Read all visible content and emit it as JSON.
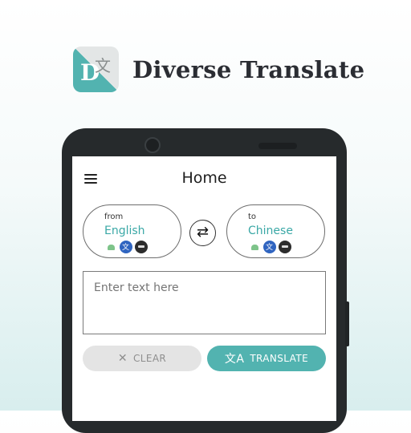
{
  "brand": {
    "logo_letter": "D",
    "logo_glyph": "文",
    "name": "Diverse Translate",
    "accent": "#52b3b0"
  },
  "app": {
    "title": "Home",
    "from": {
      "label": "from",
      "language": "English",
      "engines": [
        "android-icon",
        "google-translate-icon",
        "microsoft-icon"
      ]
    },
    "to": {
      "label": "to",
      "language": "Chinese",
      "engines": [
        "android-icon",
        "google-translate-icon",
        "microsoft-icon"
      ]
    },
    "swap_icon": "⇄",
    "input": {
      "placeholder": "Enter text here",
      "value": ""
    },
    "clear": {
      "icon": "✕",
      "label": "CLEAR"
    },
    "translate": {
      "icon": "文A",
      "label": "TRANSLATE"
    }
  }
}
